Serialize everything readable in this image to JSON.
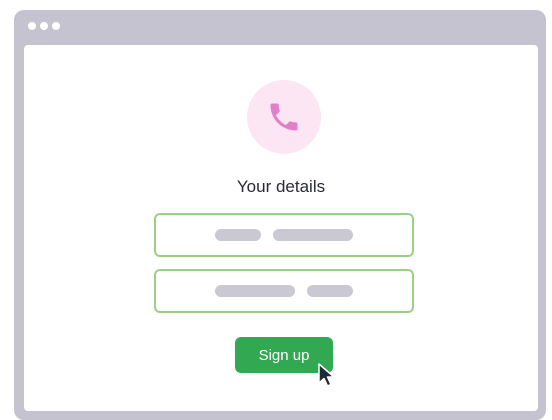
{
  "window": {
    "controls": [
      "dot",
      "dot",
      "dot"
    ]
  },
  "form": {
    "icon": "phone-icon",
    "title": "Your details",
    "fields": [
      {
        "placeholder_bars": [
          1,
          2
        ]
      },
      {
        "placeholder_bars": [
          2,
          1
        ]
      }
    ],
    "submit_label": "Sign up"
  },
  "colors": {
    "frame": "#c4c3cf",
    "icon_bg": "#fce6f4",
    "icon": "#e27fc9",
    "field_border": "#9ccf86",
    "placeholder": "#c9c8d3",
    "button": "#33a852",
    "cursor": "#1f2a34"
  }
}
